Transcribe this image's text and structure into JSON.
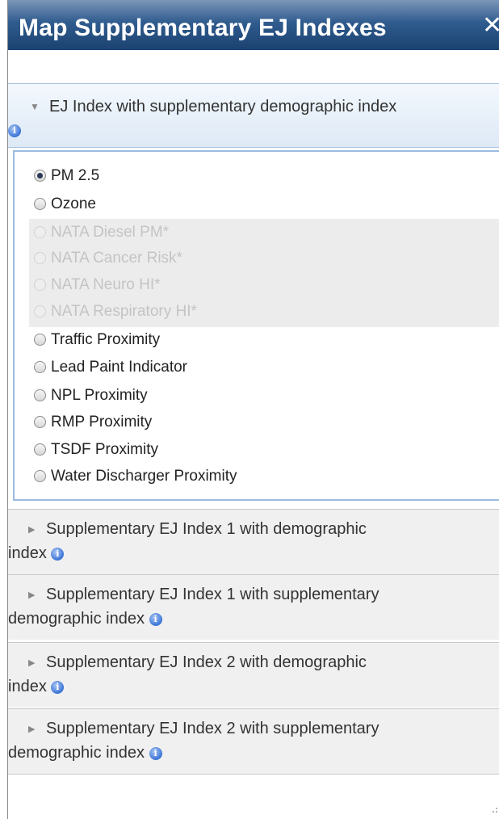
{
  "window": {
    "title": "Map Supplementary EJ Indexes",
    "close_symbol": "✕"
  },
  "expanded_section": {
    "arrow": "▼",
    "title": "EJ Index with supplementary demographic index",
    "info_icon": "info-icon",
    "options": [
      {
        "label": "PM 2.5",
        "checked": true,
        "disabled": false
      },
      {
        "label": "Ozone",
        "checked": false,
        "disabled": false
      },
      {
        "label": "NATA Diesel PM*",
        "checked": false,
        "disabled": true
      },
      {
        "label": "NATA Cancer Risk*",
        "checked": false,
        "disabled": true
      },
      {
        "label": "NATA Neuro HI*",
        "checked": false,
        "disabled": true
      },
      {
        "label": "NATA Respiratory HI*",
        "checked": false,
        "disabled": true
      },
      {
        "label": "Traffic Proximity",
        "checked": false,
        "disabled": false
      },
      {
        "label": "Lead Paint Indicator",
        "checked": false,
        "disabled": false
      },
      {
        "label": "NPL Proximity",
        "checked": false,
        "disabled": false
      },
      {
        "label": "RMP Proximity",
        "checked": false,
        "disabled": false
      },
      {
        "label": "TSDF Proximity",
        "checked": false,
        "disabled": false
      },
      {
        "label": "Water Discharger Proximity",
        "checked": false,
        "disabled": false
      }
    ]
  },
  "collapsed_sections": [
    {
      "arrow": "▶",
      "line1": "Supplementary EJ Index 1 with demographic",
      "line2": "index"
    },
    {
      "arrow": "▶",
      "line1": "Supplementary EJ Index 1 with supplementary",
      "line2": "demographic index"
    },
    {
      "arrow": "▶",
      "line1": "Supplementary EJ Index 2 with demographic",
      "line2": "index"
    },
    {
      "arrow": "▶",
      "line1": "Supplementary EJ Index 2 with supplementary",
      "line2": "demographic index"
    }
  ],
  "colors": {
    "titlebar": "#2f5b8e",
    "expanded_header": "#dde9f6",
    "accent_border": "#9bbbe0",
    "info_icon": "#3b74d6"
  }
}
